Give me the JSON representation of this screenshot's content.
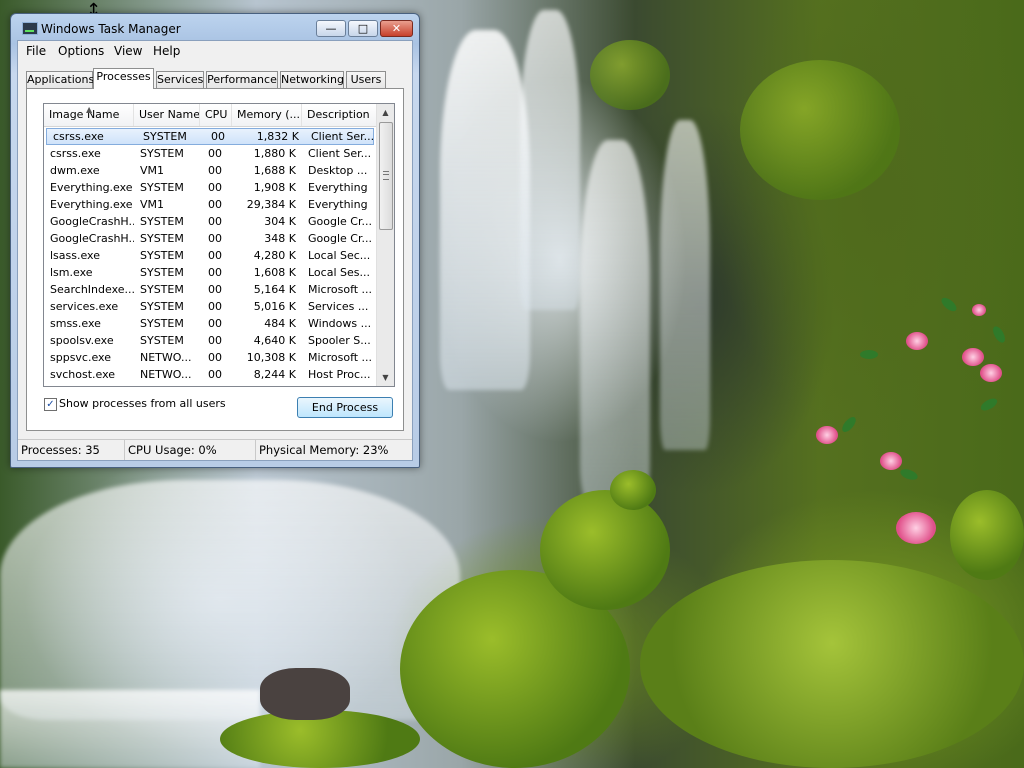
{
  "window": {
    "title": "Windows Task Manager",
    "controls": {
      "minimize": "—",
      "maximize": "□",
      "close": "✕"
    }
  },
  "menu": [
    "File",
    "Options",
    "View",
    "Help"
  ],
  "tabs": [
    "Applications",
    "Processes",
    "Services",
    "Performance",
    "Networking",
    "Users"
  ],
  "active_tab": "Processes",
  "table": {
    "columns": [
      "Image Name",
      "User Name",
      "CPU",
      "Memory (...",
      "Description"
    ],
    "sorted_column": "Image Name",
    "rows": [
      {
        "name": "csrss.exe",
        "user": "SYSTEM",
        "cpu": "00",
        "mem": "1,832 K",
        "desc": "Client Ser..."
      },
      {
        "name": "csrss.exe",
        "user": "SYSTEM",
        "cpu": "00",
        "mem": "1,880 K",
        "desc": "Client Ser..."
      },
      {
        "name": "dwm.exe",
        "user": "VM1",
        "cpu": "00",
        "mem": "1,688 K",
        "desc": "Desktop ..."
      },
      {
        "name": "Everything.exe",
        "user": "SYSTEM",
        "cpu": "00",
        "mem": "1,908 K",
        "desc": "Everything"
      },
      {
        "name": "Everything.exe",
        "user": "VM1",
        "cpu": "00",
        "mem": "29,384 K",
        "desc": "Everything"
      },
      {
        "name": "GoogleCrashH...",
        "user": "SYSTEM",
        "cpu": "00",
        "mem": "304 K",
        "desc": "Google Cr..."
      },
      {
        "name": "GoogleCrashH...",
        "user": "SYSTEM",
        "cpu": "00",
        "mem": "348 K",
        "desc": "Google Cr..."
      },
      {
        "name": "lsass.exe",
        "user": "SYSTEM",
        "cpu": "00",
        "mem": "4,280 K",
        "desc": "Local Sec..."
      },
      {
        "name": "lsm.exe",
        "user": "SYSTEM",
        "cpu": "00",
        "mem": "1,608 K",
        "desc": "Local Ses..."
      },
      {
        "name": "SearchIndexe...",
        "user": "SYSTEM",
        "cpu": "00",
        "mem": "5,164 K",
        "desc": "Microsoft ..."
      },
      {
        "name": "services.exe",
        "user": "SYSTEM",
        "cpu": "00",
        "mem": "5,016 K",
        "desc": "Services ..."
      },
      {
        "name": "smss.exe",
        "user": "SYSTEM",
        "cpu": "00",
        "mem": "484 K",
        "desc": "Windows ..."
      },
      {
        "name": "spoolsv.exe",
        "user": "SYSTEM",
        "cpu": "00",
        "mem": "4,640 K",
        "desc": "Spooler S..."
      },
      {
        "name": "sppsvc.exe",
        "user": "NETWO...",
        "cpu": "00",
        "mem": "10,308 K",
        "desc": "Microsoft ..."
      },
      {
        "name": "svchost.exe",
        "user": "NETWO...",
        "cpu": "00",
        "mem": "8,244 K",
        "desc": "Host Proc..."
      }
    ],
    "selected_row": 0
  },
  "show_all_users": {
    "label": "Show processes from all users",
    "checked": true
  },
  "end_process_label": "End Process",
  "status": {
    "processes": "Processes: 35",
    "cpu": "CPU Usage: 0%",
    "memory": "Physical Memory: 23%"
  },
  "icons": {
    "app": "task-manager-icon",
    "cursor": "resize-vertical-cursor",
    "sort": "sort-ascending-icon",
    "scroll_up": "▲",
    "scroll_down": "▼",
    "check": "✓"
  }
}
